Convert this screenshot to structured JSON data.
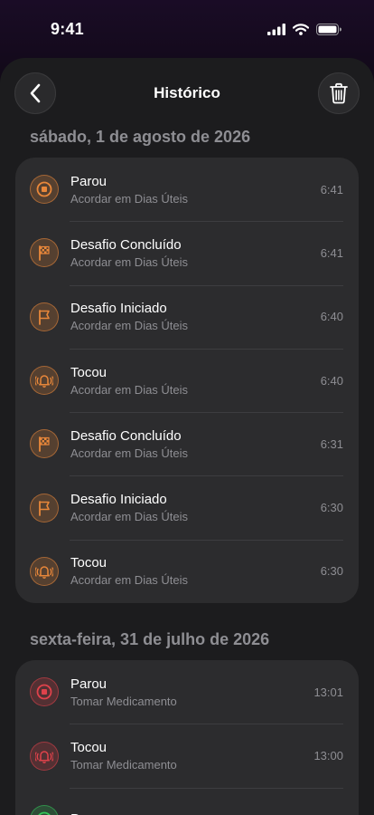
{
  "status_bar": {
    "time": "9:41"
  },
  "nav": {
    "title": "Histórico"
  },
  "colors": {
    "orange": "#e8873a",
    "red": "#e0424b",
    "green": "#34c759"
  },
  "sections": [
    {
      "date": "sábado, 1 de agosto de 2026",
      "items": [
        {
          "icon": "stop-icon",
          "color": "orange",
          "title": "Parou",
          "subtitle": "Acordar em Dias Úteis",
          "time": "6:41"
        },
        {
          "icon": "checkered-flag-icon",
          "color": "orange",
          "title": "Desafio Concluído",
          "subtitle": "Acordar em Dias Úteis",
          "time": "6:41"
        },
        {
          "icon": "flag-icon",
          "color": "orange",
          "title": "Desafio Iniciado",
          "subtitle": "Acordar em Dias Úteis",
          "time": "6:40"
        },
        {
          "icon": "ringing-bell-icon",
          "color": "orange",
          "title": "Tocou",
          "subtitle": "Acordar em Dias Úteis",
          "time": "6:40"
        },
        {
          "icon": "checkered-flag-icon",
          "color": "orange",
          "title": "Desafio Concluído",
          "subtitle": "Acordar em Dias Úteis",
          "time": "6:31"
        },
        {
          "icon": "flag-icon",
          "color": "orange",
          "title": "Desafio Iniciado",
          "subtitle": "Acordar em Dias Úteis",
          "time": "6:30"
        },
        {
          "icon": "ringing-bell-icon",
          "color": "orange",
          "title": "Tocou",
          "subtitle": "Acordar em Dias Úteis",
          "time": "6:30"
        }
      ]
    },
    {
      "date": "sexta-feira, 31 de julho de 2026",
      "items": [
        {
          "icon": "stop-icon",
          "color": "red",
          "title": "Parou",
          "subtitle": "Tomar Medicamento",
          "time": "13:01"
        },
        {
          "icon": "ringing-bell-icon",
          "color": "red",
          "title": "Tocou",
          "subtitle": "Tomar Medicamento",
          "time": "13:00"
        },
        {
          "icon": "stop-icon",
          "color": "green",
          "title": "Parou",
          "subtitle": "",
          "time": ""
        }
      ]
    }
  ]
}
